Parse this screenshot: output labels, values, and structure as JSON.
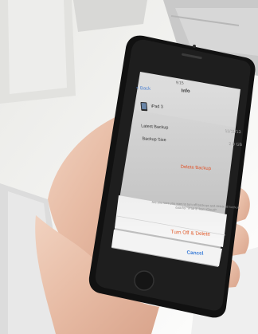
{
  "status_bar": {
    "time": "9:15"
  },
  "nav": {
    "back_label": "< Back",
    "title": "Info"
  },
  "device": {
    "name": "iPad 3"
  },
  "rows": [
    {
      "label": "Latest Backup",
      "value": "11/11/13"
    },
    {
      "label": "Backup Size",
      "value": "2.0 GB"
    }
  ],
  "delete_label": "Delete Backup",
  "action_sheet": {
    "message": "Are you sure you want to turn off backups and delete all backup data for \"iPad 3\" from iCloud?",
    "destructive_label": "Turn Off & Delete",
    "cancel_label": "Cancel"
  }
}
